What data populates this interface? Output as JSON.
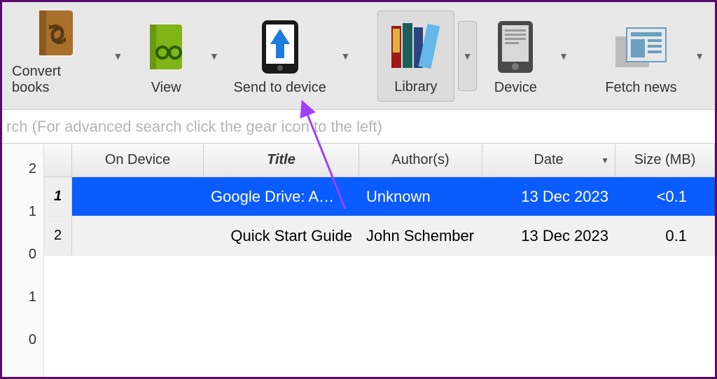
{
  "toolbar": {
    "items": [
      {
        "label": "Convert books",
        "icon": "convert-icon"
      },
      {
        "label": "View",
        "icon": "view-icon"
      },
      {
        "label": "Send to device",
        "icon": "send-device-icon"
      },
      {
        "label": "Library",
        "icon": "library-icon"
      },
      {
        "label": "Device",
        "icon": "device-icon"
      },
      {
        "label": "Fetch news",
        "icon": "news-icon"
      }
    ]
  },
  "search": {
    "placeholder": "rch (For advanced search click the gear icon to the left)"
  },
  "yaxis": [
    "2",
    "1",
    "0",
    "1",
    "0"
  ],
  "columns": {
    "on_device": "On Device",
    "title": "Title",
    "authors": "Author(s)",
    "date": "Date",
    "size": "Size (MB)"
  },
  "rows": [
    {
      "num": "1",
      "title": "Google Drive: A…",
      "author": "Unknown",
      "date": "13 Dec 2023",
      "size": "<0.1",
      "selected": true
    },
    {
      "num": "2",
      "title": "Quick Start Guide",
      "author": "John Schember",
      "date": "13 Dec 2023",
      "size": "0.1",
      "selected": false
    }
  ],
  "colors": {
    "selection": "#0a5cff",
    "annotation_arrow": "#a040ff"
  }
}
